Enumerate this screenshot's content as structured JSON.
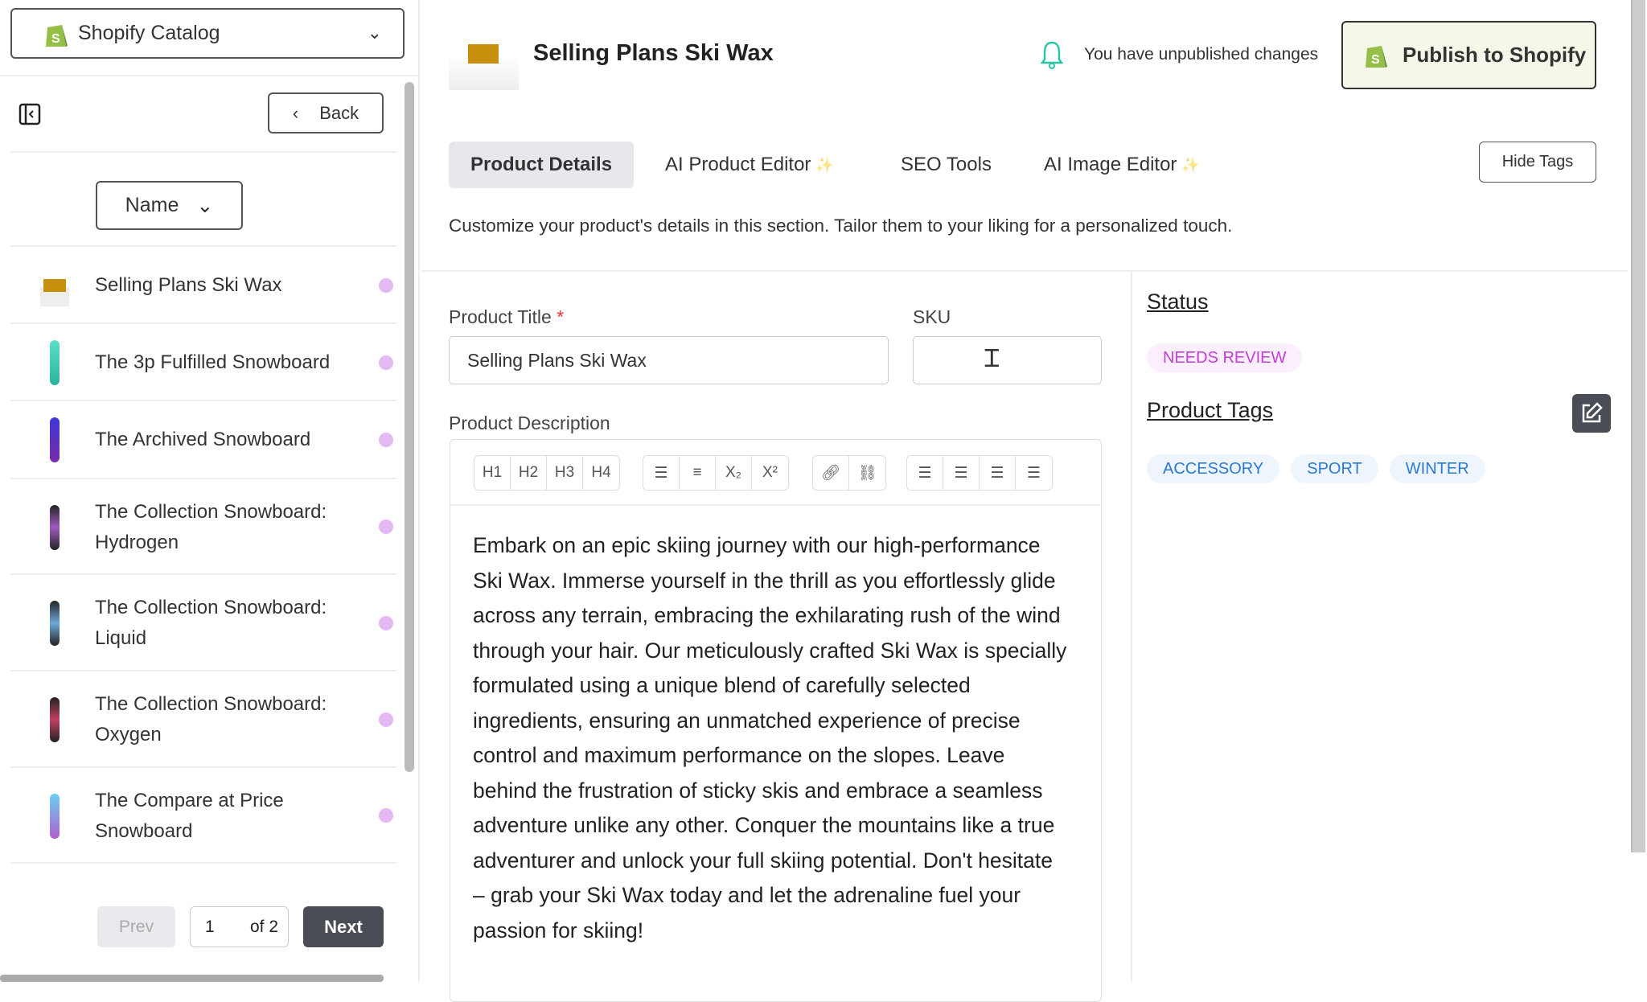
{
  "sidebar": {
    "catalog_label": "Shopify Catalog",
    "back_label": "Back",
    "sort_label": "Name",
    "items": [
      {
        "name": "Selling Plans Ski Wax"
      },
      {
        "name": "The 3p Fulfilled Snowboard"
      },
      {
        "name": "The Archived Snowboard"
      },
      {
        "name": "The Collection Snowboard: Hydrogen"
      },
      {
        "name": "The Collection Snowboard: Liquid"
      },
      {
        "name": "The Collection Snowboard: Oxygen"
      },
      {
        "name": "The Compare at Price Snowboard"
      }
    ],
    "pagination": {
      "prev": "Prev",
      "page": "1",
      "of": "of 2",
      "next": "Next"
    }
  },
  "header": {
    "title": "Selling Plans Ski Wax",
    "unpublished": "You have unpublished changes",
    "publish_label": "Publish to Shopify"
  },
  "tabs": [
    {
      "label": "Product Details",
      "active": true
    },
    {
      "label": "AI Product Editor",
      "sparkle": "✨"
    },
    {
      "label": "SEO Tools"
    },
    {
      "label": "AI Image Editor",
      "sparkle": "✨"
    }
  ],
  "hide_tags_label": "Hide Tags",
  "intro": "Customize your product's details in this section. Tailor them to your liking for a personalized touch.",
  "form": {
    "title_label": "Product Title",
    "required_mark": "*",
    "title_value": "Selling Plans Ski Wax",
    "sku_label": "SKU",
    "sku_value": "",
    "description_label": "Product Description",
    "toolbar": {
      "headings": [
        "H1",
        "H2",
        "H3",
        "H4"
      ],
      "lists": [
        "bullet-list-icon",
        "numbered-list-icon",
        "subscript-icon",
        "superscript-icon"
      ],
      "links": [
        "link-icon",
        "unlink-icon"
      ],
      "align": [
        "align-left-icon",
        "align-center-icon",
        "align-justify-icon",
        "align-right-icon"
      ]
    },
    "description": "Embark on an epic skiing journey with our high-performance Ski Wax. Immerse yourself in the thrill as you effortlessly glide across any terrain, embracing the exhilarating rush of the wind through your hair. Our meticulously crafted Ski Wax is specially formulated using a unique blend of carefully selected ingredients, ensuring an unmatched experience of precise control and maximum performance on the slopes. Leave behind the frustration of sticky skis and embrace a seamless adventure unlike any other. Conquer the mountains like a true adventurer and unlock your full skiing potential. Don't hesitate – grab your Ski Wax today and let the adrenaline fuel your passion for skiing!"
  },
  "side": {
    "status_label": "Status",
    "status_value": "NEEDS REVIEW",
    "tags_label": "Product Tags",
    "tags": [
      "ACCESSORY",
      "SPORT",
      "WINTER"
    ]
  },
  "colors": {
    "status": "#c23fd6",
    "tag": "#2a7ad6",
    "publish_bg": "#f3f8e8",
    "next_bg": "#4a4d55",
    "bell": "#2cc4a8"
  }
}
